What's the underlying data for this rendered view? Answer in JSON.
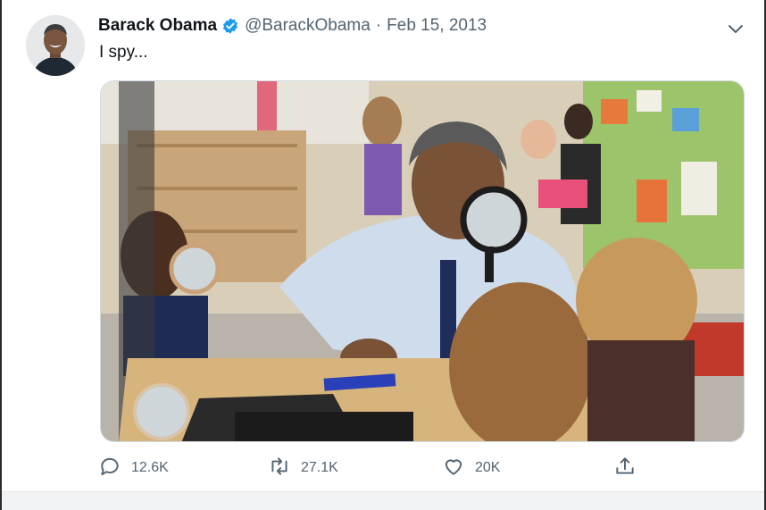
{
  "tweet": {
    "author_name": "Barack Obama",
    "handle": "@BarackObama",
    "separator": "·",
    "date": "Feb 15, 2013",
    "text": "I spy..."
  },
  "actions": {
    "reply_count": "12.6K",
    "retweet_count": "27.1K",
    "like_count": "20K"
  },
  "icons": {
    "verified": "verified-badge-icon",
    "more": "chevron-down-icon",
    "reply": "reply-icon",
    "retweet": "retweet-icon",
    "like": "heart-icon",
    "share": "share-icon"
  },
  "colors": {
    "accent": "#1d9bf0",
    "text_primary": "#0f1419",
    "text_secondary": "#536471"
  }
}
